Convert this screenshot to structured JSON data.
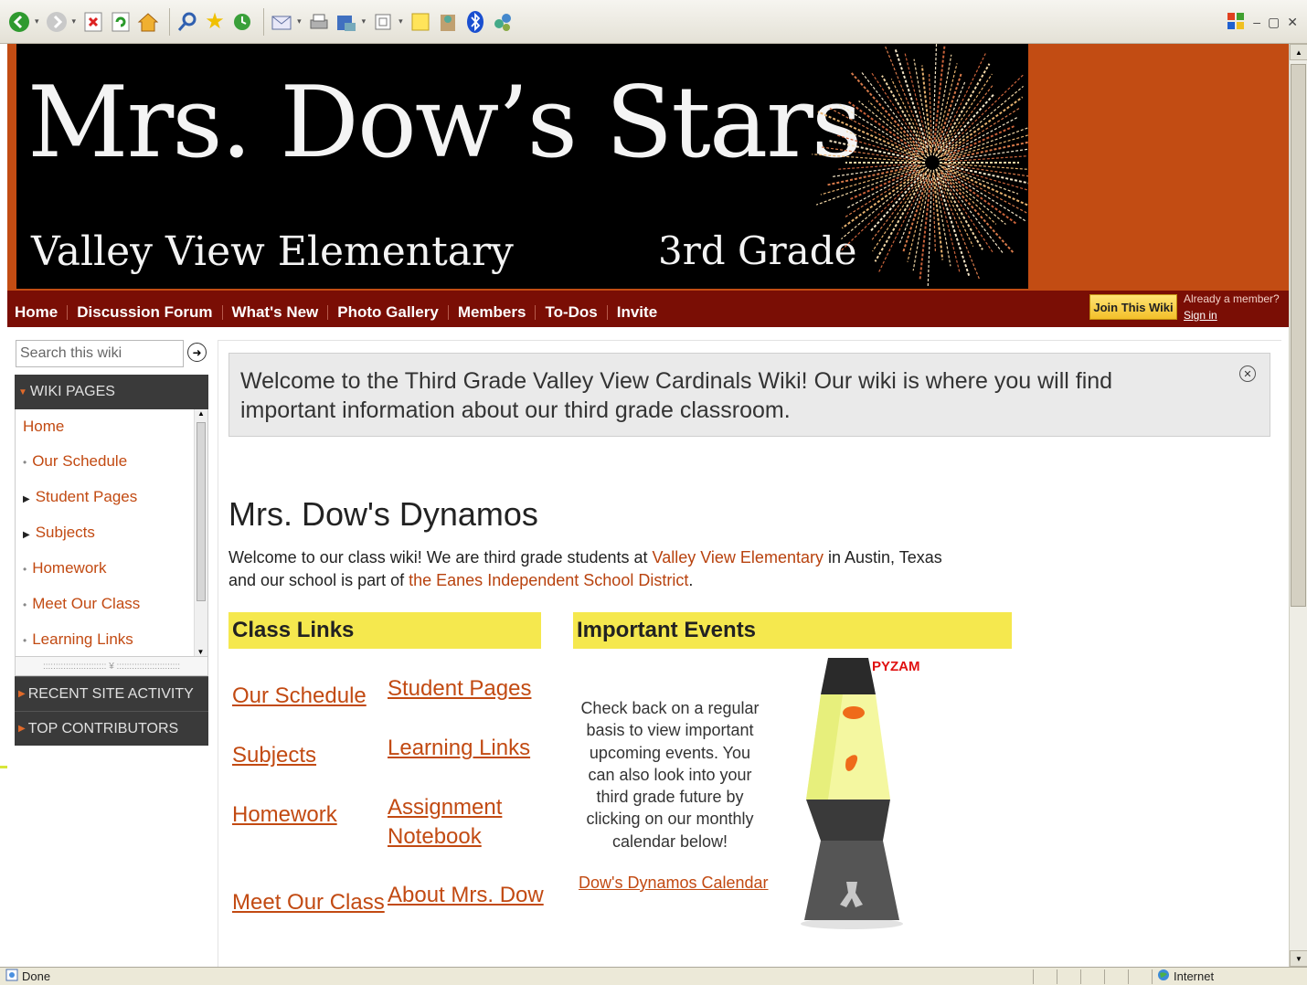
{
  "browser": {
    "toolbar_icons": [
      "back-icon",
      "forward-icon",
      "stop-icon",
      "refresh-icon",
      "home-icon",
      "search-icon",
      "favorites-icon",
      "history-icon",
      "mail-icon",
      "print-icon",
      "edit-icon",
      "zoom-icon",
      "notes-icon",
      "messenger-icon",
      "bluetooth-icon",
      "extras-icon"
    ],
    "window_controls": [
      "–",
      "▢",
      "✕"
    ],
    "status": {
      "left": "Done",
      "zone": "Internet"
    }
  },
  "banner": {
    "title": "Mrs. Dow’s Stars",
    "subtitle": "Valley View Elementary",
    "grade": "3rd Grade"
  },
  "nav": {
    "items": [
      "Home",
      "Discussion Forum",
      "What's New",
      "Photo Gallery",
      "Members",
      "To-Dos",
      "Invite"
    ],
    "join_button": "Join This Wiki",
    "already_member": "Already a member?",
    "sign_in": "Sign in"
  },
  "sidebar": {
    "search_placeholder": "Search this wiki",
    "wiki_pages_heading": "WIKI PAGES",
    "pages": [
      {
        "label": "Home",
        "marker": ""
      },
      {
        "label": "Our Schedule",
        "marker": "•"
      },
      {
        "label": "Student Pages",
        "marker": "▶"
      },
      {
        "label": "Subjects",
        "marker": "▶"
      },
      {
        "label": "Homework",
        "marker": "•"
      },
      {
        "label": "Meet Our Class",
        "marker": "•"
      },
      {
        "label": "Learning Links",
        "marker": "•"
      }
    ],
    "recent_activity_heading": "RECENT SITE ACTIVITY",
    "top_contributors_heading": "TOP CONTRIBUTORS"
  },
  "main": {
    "welcome": "Welcome to the Third Grade Valley View Cardinals Wiki! Our wiki is where you will find important information about our third grade classroom.",
    "heading": "Mrs. Dow's Dynamos",
    "intro": {
      "part1": "Welcome to our class wiki! We are third grade students at ",
      "link1": "Valley View Elementary",
      "part2": " in Austin, Texas and our school is part of ",
      "link2": "the Eanes Independent School District",
      "part3": "."
    },
    "class_links_heading": "Class Links",
    "class_links": {
      "our_schedule": "Our Schedule",
      "student_pages": "Student Pages",
      "subjects": "Subjects",
      "learning_links": "Learning Links",
      "homework": "Homework",
      "assignment_notebook_1": "Assignment",
      "assignment_notebook_2": "Notebook",
      "meet_our_class": "Meet Our Class",
      "about_mrs_dow": "About Mrs. Dow"
    },
    "events_heading": "Important Events",
    "events_text": "Check back on a regular basis to view important upcoming events. You can also look into your third grade future by clicking on our monthly calendar below!",
    "events_calendar_link": "Dow's Dynamos Calendar",
    "lava_logo": "PYZAM"
  },
  "colors": {
    "banner_orange": "#c24c13",
    "nav_dark_red": "#7a0e05",
    "link_orange": "#c24a12",
    "heading_yellow": "#f5e84e"
  }
}
